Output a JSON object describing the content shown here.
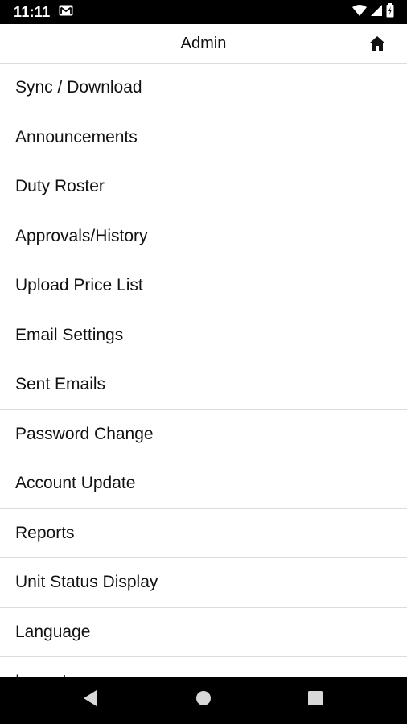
{
  "status_bar": {
    "time": "11:11",
    "icons": [
      "gmail-icon",
      "wifi-icon",
      "cell-signal-icon",
      "battery-icon"
    ]
  },
  "header": {
    "title": "Admin",
    "home_icon": "home-icon"
  },
  "menu": {
    "items": [
      {
        "label": "Sync / Download"
      },
      {
        "label": "Announcements"
      },
      {
        "label": "Duty Roster"
      },
      {
        "label": "Approvals/History"
      },
      {
        "label": "Upload Price List"
      },
      {
        "label": "Email Settings"
      },
      {
        "label": "Sent Emails"
      },
      {
        "label": "Password Change"
      },
      {
        "label": "Account Update"
      },
      {
        "label": "Reports"
      },
      {
        "label": "Unit Status Display"
      },
      {
        "label": "Language"
      },
      {
        "label": "Logout"
      }
    ]
  },
  "nav_bar": {
    "buttons": [
      "back-icon",
      "home-circle-icon",
      "recents-icon"
    ]
  },
  "colors": {
    "status_bar_bg": "#000000",
    "nav_bar_bg": "#000000",
    "divider": "#dcdcdc",
    "text": "#111111"
  }
}
